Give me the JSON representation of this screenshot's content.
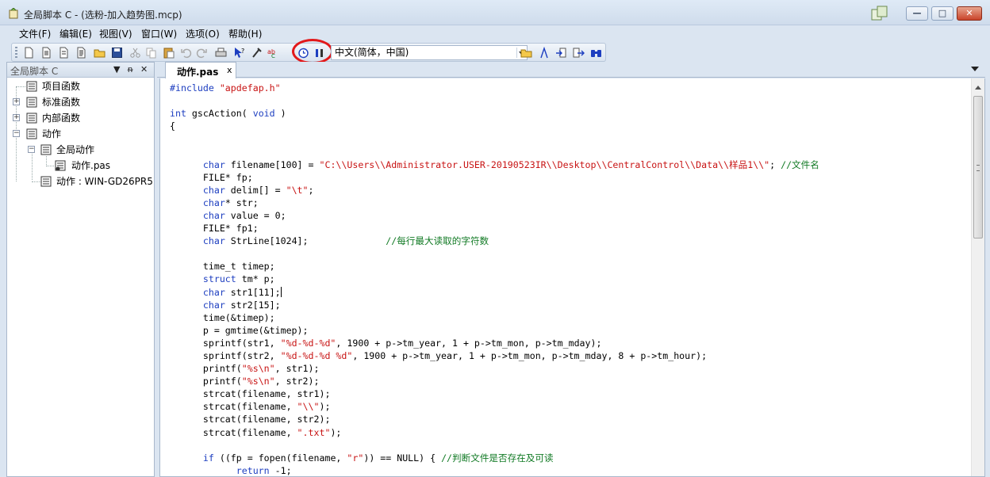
{
  "window": {
    "title": "全局脚本 C - (选粉-加入趋势图.mcp)",
    "controls": {
      "minimize": "—",
      "maximize": "□",
      "close": "✕"
    }
  },
  "menu": {
    "items": [
      {
        "label": "文件(F)"
      },
      {
        "label": "编辑(E)"
      },
      {
        "label": "视图(V)"
      },
      {
        "label": "窗口(W)"
      },
      {
        "label": "选项(O)"
      },
      {
        "label": "帮助(H)"
      }
    ]
  },
  "toolbar": {
    "language_select": "中文(简体，中国)",
    "icons": [
      "new-file-icon",
      "new-project-icon",
      "copy-doc-icon",
      "doc-icon",
      "open-folder-icon",
      "save-icon",
      "cut-icon",
      "copy-icon",
      "paste-icon",
      "undo-icon",
      "redo-icon",
      "print-icon",
      "help-pointer-icon",
      "compile-icon",
      "abc-icon",
      "trigger-clock-icon",
      "info-icon",
      "open-icon",
      "tool-icon",
      "import-icon",
      "export-icon",
      "binoculars-icon"
    ]
  },
  "tree_panel": {
    "title": "全局脚本 C",
    "pin": "ᵰ",
    "close": "✕",
    "nodes": [
      {
        "label": "项目函数",
        "expander": ""
      },
      {
        "label": "标准函数",
        "expander": "+"
      },
      {
        "label": "内部函数",
        "expander": "+"
      },
      {
        "label": "动作",
        "expander": "−"
      },
      {
        "label": "全局动作",
        "expander": "−"
      },
      {
        "label": "动作.pas",
        "expander": ""
      },
      {
        "label": "动作 : WIN-GD26PR5",
        "expander": ""
      }
    ]
  },
  "editor": {
    "tab_label": "动作.pas",
    "tab_close": "x",
    "code": [
      [
        {
          "c": "kw",
          "t": "#include "
        },
        {
          "c": "str",
          "t": "\"apdefap.h\""
        }
      ],
      [],
      [
        {
          "c": "kw",
          "t": "int"
        },
        {
          "c": "",
          "t": " gscAction( "
        },
        {
          "c": "kw",
          "t": "void"
        },
        {
          "c": "",
          "t": " )"
        }
      ],
      [
        {
          "c": "",
          "t": "{"
        }
      ],
      [],
      [],
      [
        {
          "c": "",
          "t": "      "
        },
        {
          "c": "kw",
          "t": "char"
        },
        {
          "c": "",
          "t": " filename[100] = "
        },
        {
          "c": "str",
          "t": "\"C:\\\\Users\\\\Administrator.USER-20190523IR\\\\Desktop\\\\CentralControl\\\\Data\\\\样品1\\\\\""
        },
        {
          "c": "",
          "t": "; "
        },
        {
          "c": "cm",
          "t": "//文件名"
        }
      ],
      [
        {
          "c": "",
          "t": "      FILE* fp;"
        }
      ],
      [
        {
          "c": "",
          "t": "      "
        },
        {
          "c": "kw",
          "t": "char"
        },
        {
          "c": "",
          "t": " delim[] = "
        },
        {
          "c": "str",
          "t": "\"\\t\""
        },
        {
          "c": "",
          "t": ";"
        }
      ],
      [
        {
          "c": "",
          "t": "      "
        },
        {
          "c": "kw",
          "t": "char"
        },
        {
          "c": "",
          "t": "* str;"
        }
      ],
      [
        {
          "c": "",
          "t": "      "
        },
        {
          "c": "kw",
          "t": "char"
        },
        {
          "c": "",
          "t": " value = 0;"
        }
      ],
      [
        {
          "c": "",
          "t": "      FILE* fp1;"
        }
      ],
      [
        {
          "c": "",
          "t": "      "
        },
        {
          "c": "kw",
          "t": "char"
        },
        {
          "c": "",
          "t": " StrLine[1024];              "
        },
        {
          "c": "cm",
          "t": "//每行最大读取的字符数"
        }
      ],
      [],
      [
        {
          "c": "",
          "t": "      time_t timep;"
        }
      ],
      [
        {
          "c": "",
          "t": "      "
        },
        {
          "c": "kw",
          "t": "struct"
        },
        {
          "c": "",
          "t": " tm* p;"
        }
      ],
      [
        {
          "c": "",
          "t": "      "
        },
        {
          "c": "kw",
          "t": "char"
        },
        {
          "c": "",
          "t": " str1[11];"
        },
        {
          "c": "caret",
          "t": ""
        }
      ],
      [
        {
          "c": "",
          "t": "      "
        },
        {
          "c": "kw",
          "t": "char"
        },
        {
          "c": "",
          "t": " str2[15];"
        }
      ],
      [
        {
          "c": "",
          "t": "      time(&timep);"
        }
      ],
      [
        {
          "c": "",
          "t": "      p = gmtime(&timep);"
        }
      ],
      [
        {
          "c": "",
          "t": "      sprintf(str1, "
        },
        {
          "c": "str",
          "t": "\"%d-%d-%d\""
        },
        {
          "c": "",
          "t": ", 1900 + p->tm_year, 1 + p->tm_mon, p->tm_mday);"
        }
      ],
      [
        {
          "c": "",
          "t": "      sprintf(str2, "
        },
        {
          "c": "str",
          "t": "\"%d-%d-%d %d\""
        },
        {
          "c": "",
          "t": ", 1900 + p->tm_year, 1 + p->tm_mon, p->tm_mday, 8 + p->tm_hour);"
        }
      ],
      [
        {
          "c": "",
          "t": "      printf("
        },
        {
          "c": "str",
          "t": "\"%s\\n\""
        },
        {
          "c": "",
          "t": ", str1);"
        }
      ],
      [
        {
          "c": "",
          "t": "      printf("
        },
        {
          "c": "str",
          "t": "\"%s\\n\""
        },
        {
          "c": "",
          "t": ", str2);"
        }
      ],
      [
        {
          "c": "",
          "t": "      strcat(filename, str1);"
        }
      ],
      [
        {
          "c": "",
          "t": "      strcat(filename, "
        },
        {
          "c": "str",
          "t": "\"\\\\\""
        },
        {
          "c": "",
          "t": ");"
        }
      ],
      [
        {
          "c": "",
          "t": "      strcat(filename, str2);"
        }
      ],
      [
        {
          "c": "",
          "t": "      strcat(filename, "
        },
        {
          "c": "str",
          "t": "\".txt\""
        },
        {
          "c": "",
          "t": ");"
        }
      ],
      [],
      [
        {
          "c": "",
          "t": "      "
        },
        {
          "c": "kw",
          "t": "if"
        },
        {
          "c": "",
          "t": " ((fp = fopen(filename, "
        },
        {
          "c": "str",
          "t": "\"r\""
        },
        {
          "c": "",
          "t": ")) == NULL) { "
        },
        {
          "c": "cm",
          "t": "//判断文件是否存在及可读"
        }
      ],
      [
        {
          "c": "",
          "t": "            "
        },
        {
          "c": "kw",
          "t": "return"
        },
        {
          "c": "",
          "t": " -1;"
        }
      ],
      [
        {
          "c": "",
          "t": "      }"
        }
      ]
    ]
  },
  "colors": {
    "keyword": "#1d3ec0",
    "string": "#c81414",
    "comment": "#117a24",
    "highlight_ring": "#e2191b"
  }
}
